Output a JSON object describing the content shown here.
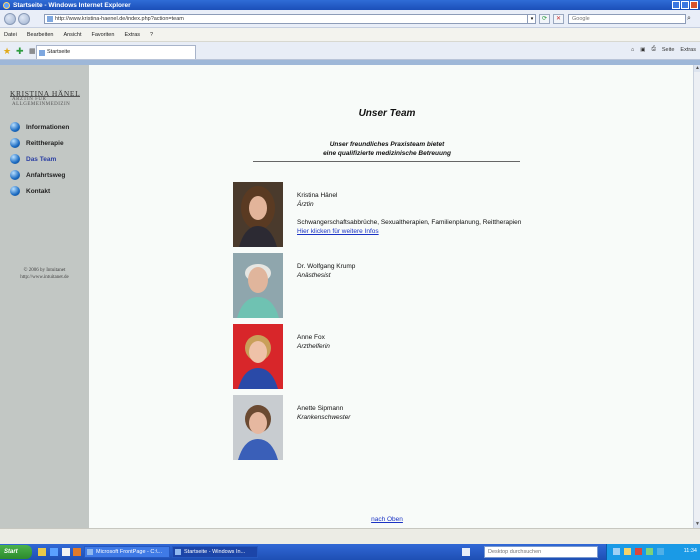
{
  "window": {
    "title": "Startseite - Windows Internet Explorer"
  },
  "browser": {
    "url": "http://www.kristina-haenel.de/index.php?action=team",
    "search_placeholder": "Google",
    "menu": [
      "Datei",
      "Bearbeiten",
      "Ansicht",
      "Favoriten",
      "Extras",
      "?"
    ],
    "tab_label": "Startseite",
    "command_bar": [
      "Seite",
      "Extras"
    ]
  },
  "sidebar": {
    "logo_name": "KRISTINA HÄNEL",
    "logo_sub": "ÄRZTIN FÜR ALLGEMEINMEDIZIN",
    "nav_items": [
      {
        "label": "Informationen"
      },
      {
        "label": "Reittherapie"
      },
      {
        "label": "Das Team"
      },
      {
        "label": "Anfahrtsweg"
      },
      {
        "label": "Kontakt"
      }
    ],
    "active_index": 2,
    "copyright_line1": "© 2006 by Intuitanet",
    "copyright_line2": "http://www.intuitanet.de"
  },
  "main": {
    "title": "Unser Team",
    "intro_line1": "Unser freundliches Praxisteam bietet",
    "intro_line2": "eine qualifizierte medizinische Betreuung",
    "members": [
      {
        "name": "Kristina Hänel",
        "role": "Ärztin",
        "extra": "Schwangerschaftsabbrüche, Sexualtherapien, Familienplanung, Reittherapien",
        "link": "Hier klicken für weitere Infos"
      },
      {
        "name": "Dr. Wolfgang Krump",
        "role": "Anästhesist"
      },
      {
        "name": "Anne Fox",
        "role": "Arzthelferin"
      },
      {
        "name": "Anette Sipmann",
        "role": "Krankenschwester"
      }
    ],
    "back_to_top": "nach Oben"
  },
  "taskbar": {
    "start_label": "Start",
    "tasks": [
      "Microsoft FrontPage - C:\\...",
      "Startseite - Windows In..."
    ],
    "active_task": 1,
    "search_placeholder": "Desktop durchsuchen",
    "clock": "11:34"
  }
}
